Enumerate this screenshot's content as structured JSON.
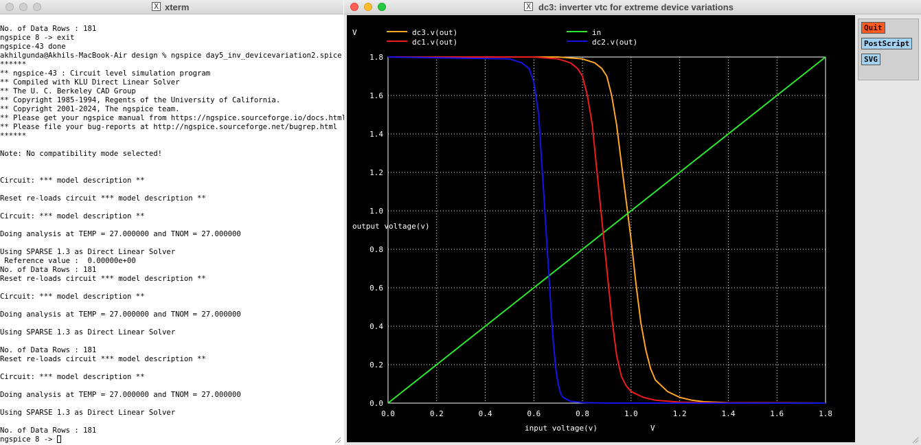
{
  "xterm": {
    "title": "xterm",
    "lines": [
      "No. of Data Rows : 181",
      "ngspice 8 -> exit",
      "ngspice-43 done",
      "akhilgunda@Akhils-MacBook-Air design % ngspice day5_inv_devicevariation2.spice",
      "******",
      "** ngspice-43 : Circuit level simulation program",
      "** Compiled with KLU Direct Linear Solver",
      "** The U. C. Berkeley CAD Group",
      "** Copyright 1985-1994, Regents of the University of California.",
      "** Copyright 2001-2024, The ngspice team.",
      "** Please get your ngspice manual from https://ngspice.sourceforge.io/docs.html",
      "** Please file your bug-reports at http://ngspice.sourceforge.net/bugrep.html",
      "******",
      "",
      "Note: No compatibility mode selected!",
      "",
      "",
      "Circuit: *** model description **",
      "",
      "Reset re-loads circuit *** model description **",
      "",
      "Circuit: *** model description **",
      "",
      "Doing analysis at TEMP = 27.000000 and TNOM = 27.000000",
      "",
      "Using SPARSE 1.3 as Direct Linear Solver",
      " Reference value :  0.00000e+00",
      "No. of Data Rows : 181",
      "Reset re-loads circuit *** model description **",
      "",
      "Circuit: *** model description **",
      "",
      "Doing analysis at TEMP = 27.000000 and TNOM = 27.000000",
      "",
      "Using SPARSE 1.3 as Direct Linear Solver",
      "",
      "No. of Data Rows : 181",
      "Reset re-loads circuit *** model description **",
      "",
      "Circuit: *** model description **",
      "",
      "Doing analysis at TEMP = 27.000000 and TNOM = 27.000000",
      "",
      "Using SPARSE 1.3 as Direct Linear Solver",
      "",
      "No. of Data Rows : 181"
    ],
    "prompt": "ngspice 8 -> "
  },
  "plot_window": {
    "title": "dc3: inverter vtc for extreme device variations",
    "buttons": {
      "quit": "Quit",
      "postscript": "PostScript",
      "svg": "SVG"
    }
  },
  "colors": {
    "dc3": "#ffa824",
    "in": "#2ee82e",
    "dc1": "#ee1c1c",
    "dc2": "#1414e8",
    "grid": "#ffffff",
    "plot_bg": "#000000"
  },
  "chart_data": {
    "type": "line",
    "title": "",
    "xlabel": "input voltage(v)",
    "xunit": "V",
    "ylabel": "output voltage(v)",
    "yunit": "V",
    "xlim": [
      0,
      1.8
    ],
    "ylim": [
      0,
      1.8
    ],
    "xticks": [
      "0.0",
      "0.2",
      "0.4",
      "0.6",
      "0.8",
      "1.0",
      "1.2",
      "1.4",
      "1.6",
      "1.8"
    ],
    "yticks": [
      "0.0",
      "0.2",
      "0.4",
      "0.6",
      "0.8",
      "1.0",
      "1.2",
      "1.4",
      "1.6",
      "1.8"
    ],
    "grid": true,
    "grid_style": "dotted",
    "legend_placement": "top",
    "series": [
      {
        "name": "dc3.v(out)",
        "color_key": "dc3",
        "x": [
          0,
          0.7,
          0.8,
          0.85,
          0.88,
          0.9,
          0.92,
          0.94,
          0.96,
          0.98,
          1.0,
          1.02,
          1.04,
          1.06,
          1.08,
          1.1,
          1.15,
          1.2,
          1.25,
          1.3,
          1.4,
          1.8
        ],
        "y": [
          1.8,
          1.8,
          1.79,
          1.77,
          1.74,
          1.7,
          1.6,
          1.45,
          1.25,
          1.05,
          0.85,
          0.62,
          0.42,
          0.28,
          0.18,
          0.12,
          0.06,
          0.03,
          0.015,
          0.007,
          0.002,
          0
        ]
      },
      {
        "name": "in",
        "color_key": "in",
        "x": [
          0,
          1.8
        ],
        "y": [
          0,
          1.8
        ]
      },
      {
        "name": "dc1.v(out)",
        "color_key": "dc1",
        "x": [
          0,
          0.6,
          0.7,
          0.75,
          0.78,
          0.8,
          0.82,
          0.84,
          0.86,
          0.88,
          0.9,
          0.92,
          0.94,
          0.96,
          0.98,
          1.0,
          1.05,
          1.1,
          1.2,
          1.3,
          1.8
        ],
        "y": [
          1.8,
          1.8,
          1.79,
          1.77,
          1.74,
          1.7,
          1.6,
          1.45,
          1.2,
          0.95,
          0.7,
          0.45,
          0.25,
          0.14,
          0.09,
          0.06,
          0.03,
          0.015,
          0.005,
          0.002,
          0
        ]
      },
      {
        "name": "dc2.v(out)",
        "color_key": "dc2",
        "x": [
          0,
          0.5,
          0.55,
          0.58,
          0.6,
          0.62,
          0.63,
          0.64,
          0.65,
          0.66,
          0.67,
          0.68,
          0.69,
          0.7,
          0.71,
          0.72,
          0.75,
          0.8,
          0.9,
          1.8
        ],
        "y": [
          1.8,
          1.79,
          1.77,
          1.74,
          1.67,
          1.5,
          1.3,
          1.1,
          0.9,
          0.7,
          0.5,
          0.32,
          0.18,
          0.1,
          0.05,
          0.03,
          0.01,
          0.003,
          0,
          0
        ]
      }
    ]
  }
}
